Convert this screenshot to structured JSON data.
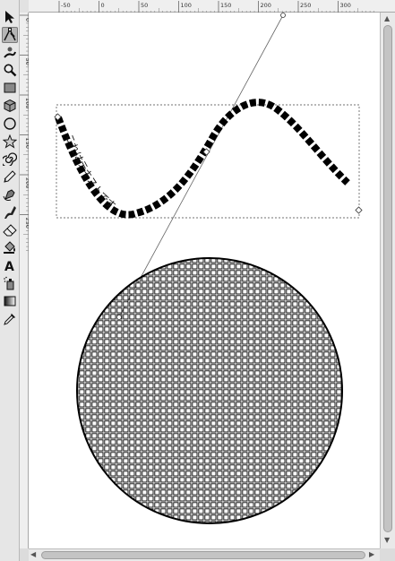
{
  "toolbar": {
    "tools": [
      {
        "id": "selector",
        "icon": "arrow-pointer-icon"
      },
      {
        "id": "node-editor",
        "icon": "node-edit-icon"
      },
      {
        "id": "tweak",
        "icon": "tweak-brush-icon"
      },
      {
        "id": "zoom",
        "icon": "magnifier-icon"
      },
      {
        "id": "rectangle",
        "icon": "rectangle-icon"
      },
      {
        "id": "3d-box",
        "icon": "cube-icon"
      },
      {
        "id": "ellipse",
        "icon": "circle-icon"
      },
      {
        "id": "star",
        "icon": "star-icon"
      },
      {
        "id": "spiral",
        "icon": "spiral-icon"
      },
      {
        "id": "pencil",
        "icon": "pencil-icon"
      },
      {
        "id": "pen",
        "icon": "pen-icon"
      },
      {
        "id": "calligraphy",
        "icon": "calligraphy-icon"
      },
      {
        "id": "eraser",
        "icon": "eraser-icon"
      },
      {
        "id": "paint-bucket",
        "icon": "paint-bucket-icon"
      },
      {
        "id": "text",
        "icon": "text-tool-icon"
      },
      {
        "id": "spray",
        "icon": "spray-icon"
      },
      {
        "id": "gradient",
        "icon": "gradient-icon"
      },
      {
        "id": "dropper",
        "icon": "dropper-icon"
      }
    ],
    "active_tool": "node-editor"
  },
  "rulers": {
    "horizontal_labels": [
      "-50",
      "0",
      "50",
      "100",
      "150",
      "200",
      "250",
      "300"
    ],
    "vertical_labels": [
      "0",
      "50",
      "100",
      "150",
      "200",
      "250"
    ]
  },
  "canvas": {
    "path_text": "これはテキストです",
    "colors": {
      "canvas": "#ffffff",
      "ink": "#000000",
      "guide": "#555555"
    }
  }
}
